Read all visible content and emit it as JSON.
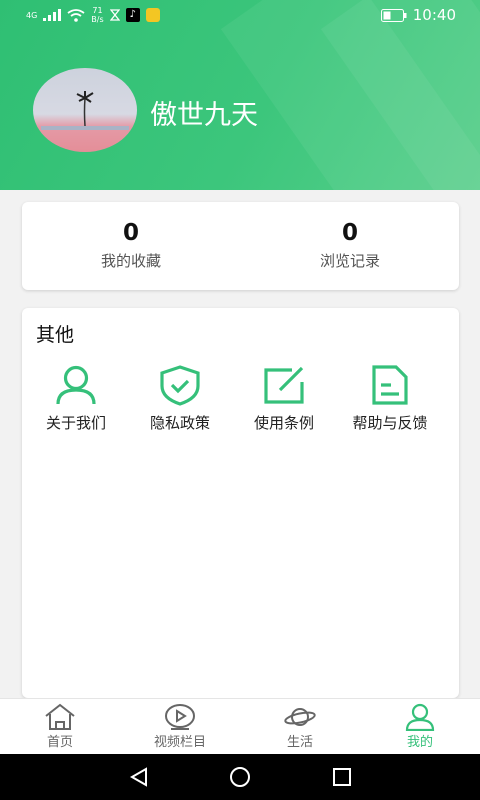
{
  "status_bar": {
    "network_label": "4G",
    "speed_value": "71",
    "speed_unit": "B/s",
    "time": "10:40"
  },
  "profile": {
    "username": "傲世九天"
  },
  "stats": [
    {
      "value": "0",
      "label": "我的收藏"
    },
    {
      "value": "0",
      "label": "浏览记录"
    }
  ],
  "other": {
    "title": "其他",
    "items": [
      {
        "label": "关于我们",
        "icon": "user-icon"
      },
      {
        "label": "隐私政策",
        "icon": "shield-check-icon"
      },
      {
        "label": "使用条例",
        "icon": "edit-icon"
      },
      {
        "label": "帮助与反馈",
        "icon": "document-icon"
      }
    ]
  },
  "tabs": [
    {
      "label": "首页",
      "icon": "home-icon",
      "active": false
    },
    {
      "label": "视频栏目",
      "icon": "play-icon",
      "active": false
    },
    {
      "label": "生活",
      "icon": "planet-icon",
      "active": false
    },
    {
      "label": "我的",
      "icon": "person-icon",
      "active": true
    }
  ],
  "colors": {
    "accent": "#35c07a",
    "header_start": "#2fbf73",
    "header_end": "#58cf8b"
  }
}
